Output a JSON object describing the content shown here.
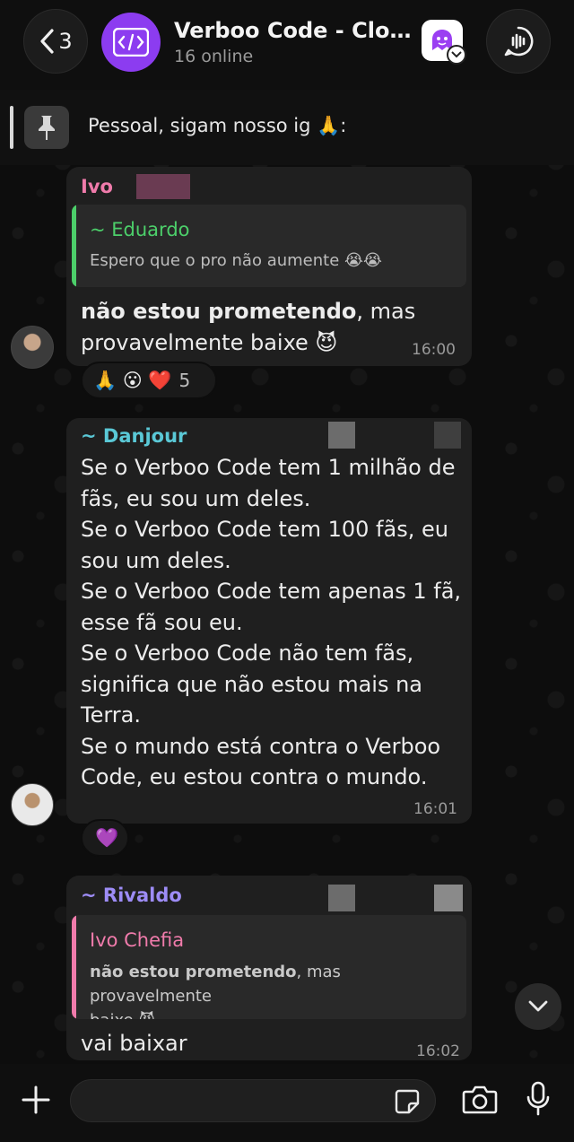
{
  "header": {
    "back_count": "3",
    "title": "Verboo Code - Closed...",
    "subtitle": "16 online"
  },
  "pinned": {
    "text": "Pessoal, sigam nosso ig 🙏:"
  },
  "messages": [
    {
      "sender": "Ivo",
      "quote_sender": "~ Eduardo",
      "quote_text": "Espero que o pro não aumente 😭😭",
      "text_bold": "não estou prometendo",
      "text_rest": ", mas",
      "text_line2": "provavelmente baixe 😈",
      "time": "16:00",
      "reactions": {
        "emojis": "🙏 😮 ❤️",
        "count": "5"
      }
    },
    {
      "sender": "~ Danjour",
      "lines": [
        "Se o Verboo Code tem 1 milhão de",
        "fãs, eu sou um deles.",
        "Se o Verboo Code tem 100 fãs, eu",
        "sou um deles.",
        "Se o Verboo Code tem apenas 1 fã,",
        "esse fã sou eu.",
        "Se o Verboo Code não tem fãs,",
        "significa que não estou mais na",
        "Terra.",
        "Se o mundo está contra o Verboo",
        "Code, eu estou contra o mundo."
      ],
      "time": "16:01",
      "reactions": {
        "emojis": "💜"
      }
    },
    {
      "sender": "~ Rivaldo",
      "quote_sender": "Ivo Chefia",
      "quote_bold": "não estou prometendo",
      "quote_rest": ", mas provavelmente",
      "quote_line2": "baixe 😈",
      "text": "vai baixar",
      "time": "16:02"
    }
  ],
  "colors": {
    "accent_purple": "#8c3cf0",
    "quote_green": "#4ccf6a",
    "quote_pink": "#f07bab",
    "bubble_bg": "#1f1f1f"
  },
  "icons": [
    "back-chevron-icon",
    "code-icon",
    "app-logo-icon",
    "voice-call-icon",
    "pin-icon",
    "chevron-down-icon",
    "plus-icon",
    "sticker-icon",
    "camera-icon",
    "microphone-icon"
  ]
}
